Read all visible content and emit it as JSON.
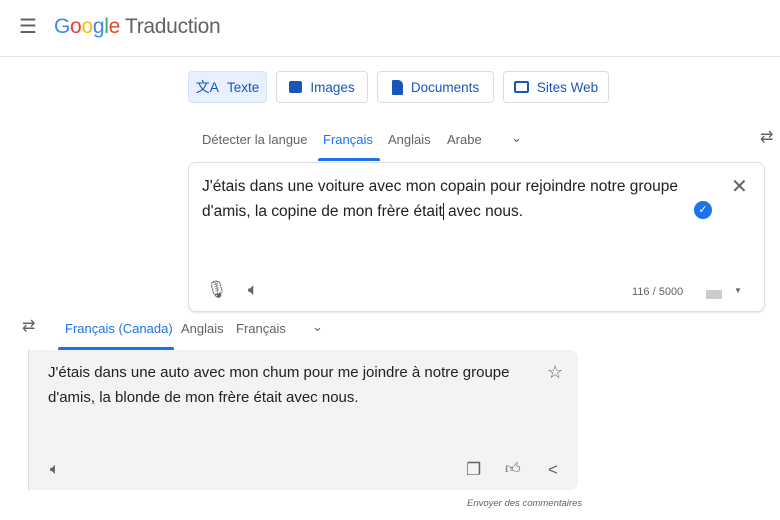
{
  "header": {
    "menu_icon": "hamburger-icon",
    "logo": "Google",
    "app_name": "Traduction"
  },
  "modes": [
    {
      "label": "Texte",
      "icon": "translate-icon",
      "active": true
    },
    {
      "label": "Images",
      "icon": "image-icon"
    },
    {
      "label": "Documents",
      "icon": "document-icon"
    },
    {
      "label": "Sites Web",
      "icon": "web-icon"
    }
  ],
  "source": {
    "languages": [
      "Détecter la langue",
      "Français",
      "Anglais",
      "Arabe"
    ],
    "selected": "Français",
    "text_before_cursor": "J'étais dans une voiture avec mon copain pour rejoindre notre groupe d'amis, la copine de mon frère était",
    "text_after_cursor": " avec nous.",
    "char_count": "116 / 5000"
  },
  "target": {
    "languages": [
      "Français (Canada)",
      "Anglais",
      "Français"
    ],
    "selected": "Français (Canada)",
    "text": "J'étais dans une auto avec mon chum pour me joindre à notre groupe d'amis, la blonde de mon frère était avec nous.",
    "feedback_link": "Envoyer des commentaires"
  },
  "colors": {
    "accent": "#1a73e8",
    "output_bg": "#f3f3f3"
  }
}
